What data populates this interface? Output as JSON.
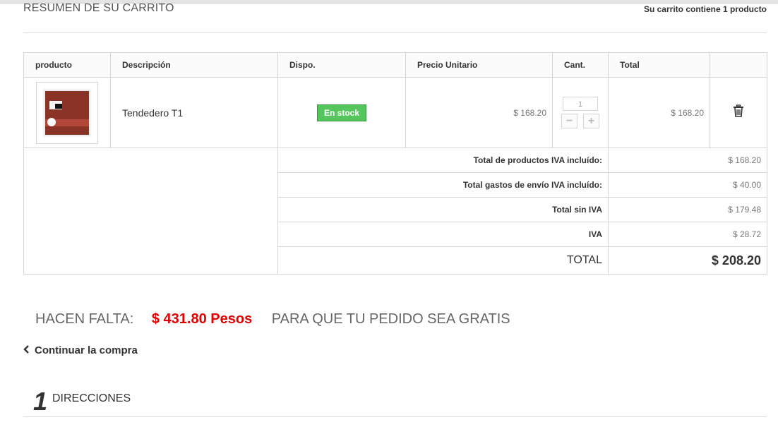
{
  "header": {
    "title": "Resumen de su carrito",
    "cart_count": "Su carrito contiene 1 producto"
  },
  "table": {
    "columns": [
      "producto",
      "Descripción",
      "Dispo.",
      "Precio Unitario",
      "Cant.",
      "Total"
    ],
    "item": {
      "description": "Tendedero T1",
      "availability": "En stock",
      "unit_price": "$ 168.20",
      "quantity": "1",
      "total": "$ 168.20",
      "minus_label": "−",
      "plus_label": "+"
    },
    "summary": [
      {
        "label": "Total de productos IVA incluído:",
        "value": "$ 168.20"
      },
      {
        "label": "Total gastos de envío IVA incluído:",
        "value": "$ 40.00"
      },
      {
        "label": "Total sin IVA",
        "value": "$ 179.48"
      },
      {
        "label": "IVA",
        "value": "$ 28.72"
      }
    ],
    "grand_total": {
      "label": "TOTAL",
      "value": "$ 208.20"
    }
  },
  "free_shipping": {
    "prefix": "HACEN FALTA:",
    "amount": "$ 431.80 Pesos",
    "suffix": "PARA QUE TU PEDIDO SEA GRATIS"
  },
  "continue_label": "Continuar la compra",
  "step": {
    "number": "1",
    "title": "DIRECCIONES"
  },
  "colors": {
    "stock_badge": "#55c65e",
    "remaining_amount": "#e00000"
  },
  "icons": {
    "delete": "trash-icon",
    "continue": "chevron-left-icon"
  }
}
